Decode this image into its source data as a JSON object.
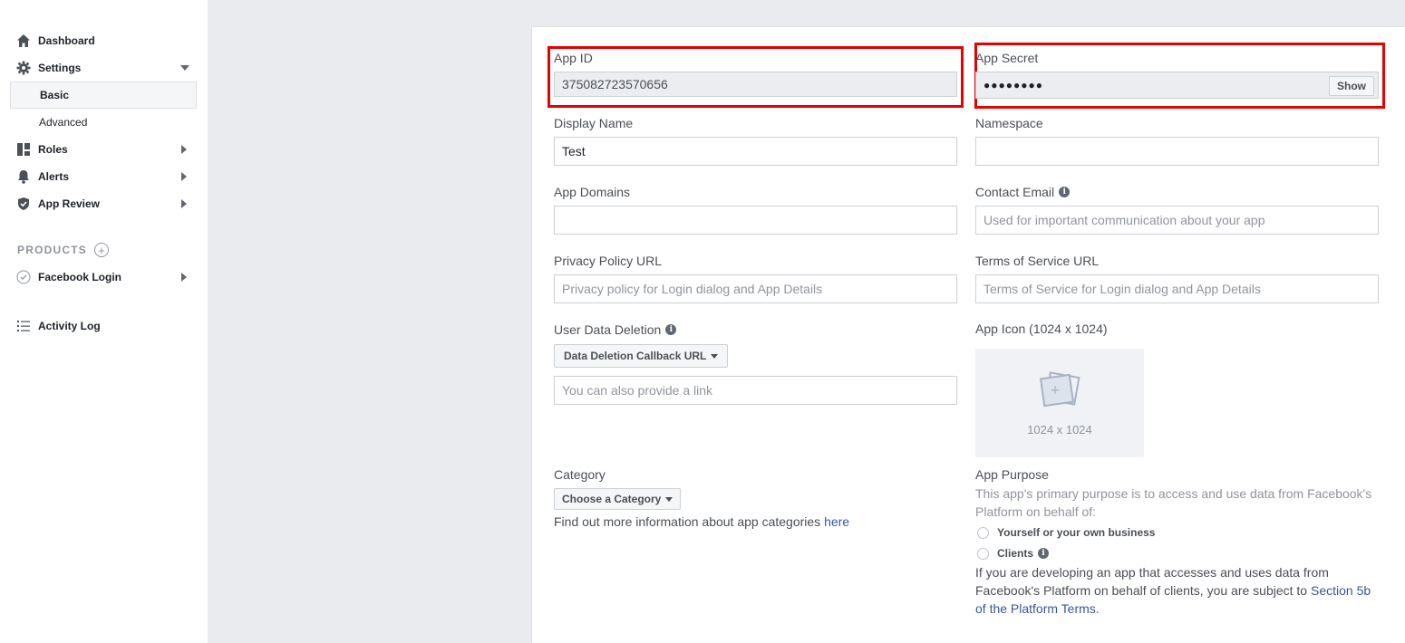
{
  "sidebar": {
    "items": [
      {
        "label": "Dashboard",
        "icon": "home-icon"
      },
      {
        "label": "Settings",
        "icon": "gear-icon"
      },
      {
        "label": "Roles",
        "icon": "roles-icon"
      },
      {
        "label": "Alerts",
        "icon": "bell-icon"
      },
      {
        "label": "App Review",
        "icon": "shield-icon"
      }
    ],
    "settings_sub": [
      {
        "label": "Basic",
        "active": true
      },
      {
        "label": "Advanced",
        "active": false
      }
    ],
    "products_heading": "PRODUCTS",
    "products": [
      {
        "label": "Facebook Login",
        "icon": "check-circle-icon"
      }
    ],
    "activity_log": "Activity Log"
  },
  "form": {
    "app_id": {
      "label": "App ID",
      "value": "375082723570656"
    },
    "app_secret": {
      "label": "App Secret",
      "value": "●●●●●●●●",
      "show_label": "Show"
    },
    "display_name": {
      "label": "Display Name",
      "value": "Test"
    },
    "namespace": {
      "label": "Namespace",
      "value": ""
    },
    "app_domains": {
      "label": "App Domains",
      "value": ""
    },
    "contact_email": {
      "label": "Contact Email",
      "placeholder": "Used for important communication about your app"
    },
    "privacy_policy": {
      "label": "Privacy Policy URL",
      "placeholder": "Privacy policy for Login dialog and App Details"
    },
    "terms_of_service": {
      "label": "Terms of Service URL",
      "placeholder": "Terms of Service for Login dialog and App Details"
    },
    "user_data_deletion": {
      "label": "User Data Deletion",
      "dropdown": "Data Deletion Callback URL",
      "placeholder": "You can also provide a link"
    },
    "app_icon": {
      "label": "App Icon (1024 x 1024)",
      "box_text": "1024 x 1024"
    },
    "category": {
      "label": "Category",
      "dropdown": "Choose a Category",
      "help_text": "Find out more information about app categories ",
      "help_link": "here"
    },
    "app_purpose": {
      "label": "App Purpose",
      "description": "This app's primary purpose is to access and use data from Facebook's Platform on behalf of:",
      "options": [
        "Yourself or your own business",
        "Clients"
      ],
      "note": "If you are developing an app that accesses and uses data from Facebook's Platform on behalf of clients, you are subject to ",
      "note_link": "Section 5b of the Platform Terms",
      "note_end": "."
    }
  },
  "colors": {
    "highlight": "#e60000",
    "link": "#365899",
    "background": "#e9ebee"
  }
}
